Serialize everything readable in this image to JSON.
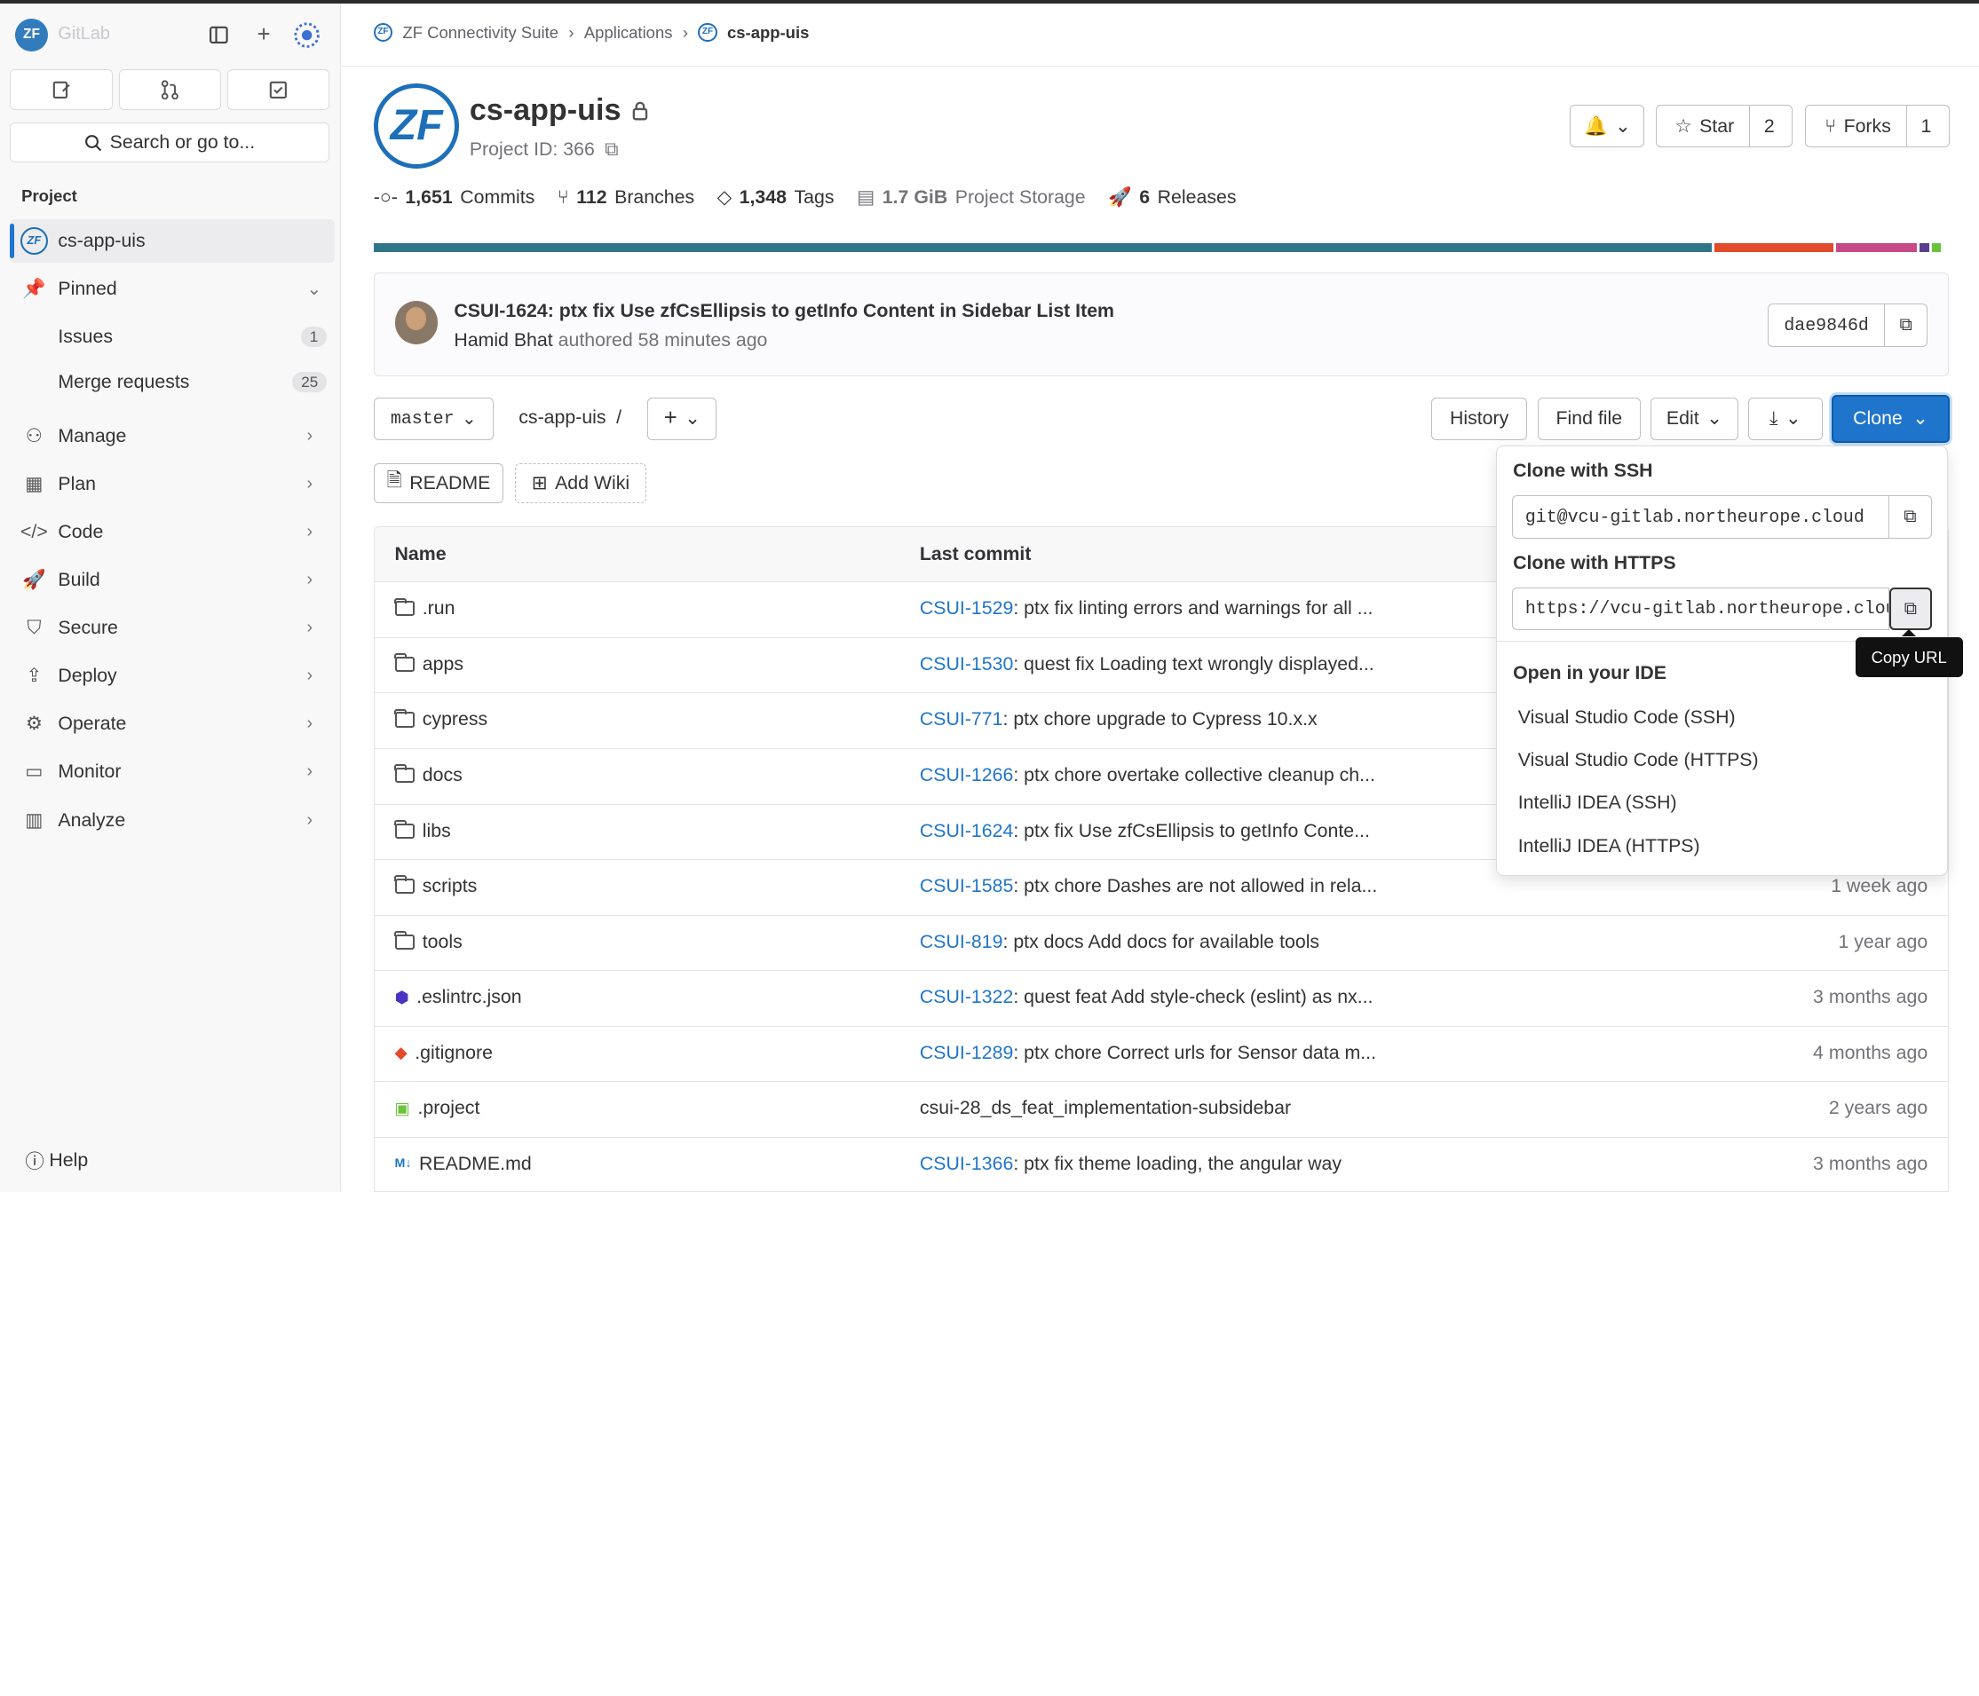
{
  "sidebar": {
    "brand": "GitLab",
    "search_label": "Search or go to...",
    "section": "Project",
    "project_name": "cs-app-uis",
    "pinned": "Pinned",
    "issues": {
      "label": "Issues",
      "count": "1"
    },
    "merge_requests": {
      "label": "Merge requests",
      "count": "25"
    },
    "nav": [
      "Manage",
      "Plan",
      "Code",
      "Build",
      "Secure",
      "Deploy",
      "Operate",
      "Monitor",
      "Analyze"
    ],
    "help": "Help"
  },
  "breadcrumb": {
    "group": "ZF Connectivity Suite",
    "sub": "Applications",
    "current": "cs-app-uis"
  },
  "project": {
    "logo_text": "ZF",
    "title": "cs-app-uis",
    "id_label": "Project ID: 366",
    "star_label": "Star",
    "star_count": "2",
    "forks_label": "Forks",
    "forks_count": "1"
  },
  "stats": {
    "commits_n": "1,651",
    "commits_l": "Commits",
    "branches_n": "112",
    "branches_l": "Branches",
    "tags_n": "1,348",
    "tags_l": "Tags",
    "storage_n": "1.7 GiB",
    "storage_l": "Project Storage",
    "releases_n": "6",
    "releases_l": "Releases"
  },
  "language_bar": [
    {
      "color": "#2f7686",
      "fraction": 0.855
    },
    {
      "color": "#e24a2a",
      "fraction": 0.076
    },
    {
      "color": "#c7498a",
      "fraction": 0.052
    },
    {
      "color": "#5b3e8e",
      "fraction": 0.006
    },
    {
      "color": "#6bc33a",
      "fraction": 0.006
    }
  ],
  "last_commit": {
    "title": "CSUI-1624: ptx fix Use zfCsEllipsis to getInfo Content in Sidebar List Item",
    "author": "Hamid Bhat",
    "meta": "authored 58 minutes ago",
    "sha": "dae9846d"
  },
  "toolbar": {
    "branch": "master",
    "path": "cs-app-uis",
    "path_sep": "/",
    "history": "History",
    "find_file": "Find file",
    "edit": "Edit",
    "clone": "Clone",
    "readme": "README",
    "add_wiki": "Add Wiki"
  },
  "table": {
    "headers": {
      "name": "Name",
      "last_commit": "Last commit"
    },
    "rows": [
      {
        "name": ".run",
        "link": "CSUI-1529",
        "msg": ": ptx fix linting errors and warnings for all ...",
        "age": ""
      },
      {
        "name": "apps",
        "link": "CSUI-1530",
        "msg": ": quest fix Loading text wrongly displayed...",
        "age": ""
      },
      {
        "name": "cypress",
        "link": "CSUI-771",
        "msg": ": ptx chore upgrade to Cypress 10.x.x",
        "age": ""
      },
      {
        "name": "docs",
        "link": "CSUI-1266",
        "msg": ": ptx chore overtake collective cleanup ch...",
        "age": ""
      },
      {
        "name": "libs",
        "link": "CSUI-1624",
        "msg": ": ptx fix Use zfCsEllipsis to getInfo Conte...",
        "age": ""
      },
      {
        "name": "scripts",
        "link": "CSUI-1585",
        "msg": ": ptx chore Dashes are not allowed in rela...",
        "age": "1 week ago"
      },
      {
        "name": "tools",
        "link": "CSUI-819",
        "msg": ": ptx docs Add docs for available tools",
        "age": "1 year ago"
      },
      {
        "name": ".eslintrc.json",
        "link": "CSUI-1322",
        "msg": ": quest feat Add style-check (eslint) as nx...",
        "age": "3 months ago"
      },
      {
        "name": ".gitignore",
        "link": "CSUI-1289",
        "msg": ": ptx chore Correct urls for Sensor data m...",
        "age": "4 months ago"
      },
      {
        "name": ".project",
        "link": "",
        "msg": "csui-28_ds_feat_implementation-subsidebar",
        "age": "2 years ago"
      },
      {
        "name": "README.md",
        "link": "CSUI-1366",
        "msg": ": ptx fix theme loading, the angular way",
        "age": "3 months ago"
      }
    ]
  },
  "clone_dropdown": {
    "ssh_title": "Clone with SSH",
    "ssh_url": "git@vcu-gitlab.northeurope.cloud",
    "https_title": "Clone with HTTPS",
    "https_url": "https://vcu-gitlab.northeurope.cloud",
    "ide_title": "Open in your IDE",
    "ide_items": [
      "Visual Studio Code (SSH)",
      "Visual Studio Code (HTTPS)",
      "IntelliJ IDEA (SSH)",
      "IntelliJ IDEA (HTTPS)"
    ],
    "tooltip": "Copy URL"
  }
}
